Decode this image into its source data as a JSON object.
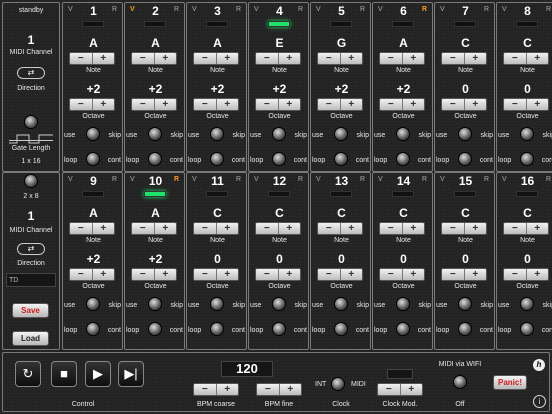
{
  "colors": {
    "accent_orange": "#ff9a1f",
    "led_green": "#1ee36a",
    "save_red": "#d21a1a"
  },
  "left": {
    "status": "standby",
    "midi_channel_top": "1",
    "midi_channel_label": "MIDI Channel",
    "direction_label": "Direction",
    "gate_length_label": "Gate Length",
    "mode_a": "1 x 16",
    "mode_b": "2 x 8",
    "midi_channel_bottom": "1",
    "midi_channel_label_2": "MIDI Channel",
    "direction_label_2": "Direction",
    "preset_field": "TD",
    "save_label": "Save",
    "load_label": "Load"
  },
  "steps": [
    {
      "n": "1",
      "v": "V",
      "r": "R",
      "note": "A",
      "octave": "+2",
      "active": false,
      "v_orange": false,
      "r_orange": false
    },
    {
      "n": "2",
      "v": "V",
      "r": "R",
      "note": "A",
      "octave": "+2",
      "active": false,
      "v_orange": true,
      "r_orange": false
    },
    {
      "n": "3",
      "v": "V",
      "r": "R",
      "note": "A",
      "octave": "+2",
      "active": false,
      "v_orange": false,
      "r_orange": false
    },
    {
      "n": "4",
      "v": "V",
      "r": "R",
      "note": "E",
      "octave": "+2",
      "active": true,
      "v_orange": false,
      "r_orange": false
    },
    {
      "n": "5",
      "v": "V",
      "r": "R",
      "note": "G",
      "octave": "+2",
      "active": false,
      "v_orange": false,
      "r_orange": false
    },
    {
      "n": "6",
      "v": "V",
      "r": "R",
      "note": "A",
      "octave": "+2",
      "active": false,
      "v_orange": false,
      "r_orange": true
    },
    {
      "n": "7",
      "v": "V",
      "r": "R",
      "note": "C",
      "octave": "0",
      "active": false,
      "v_orange": false,
      "r_orange": false
    },
    {
      "n": "8",
      "v": "V",
      "r": "R",
      "note": "C",
      "octave": "0",
      "active": false,
      "v_orange": false,
      "r_orange": false
    },
    {
      "n": "9",
      "v": "V",
      "r": "R",
      "note": "A",
      "octave": "+2",
      "active": false,
      "v_orange": false,
      "r_orange": false
    },
    {
      "n": "10",
      "v": "V",
      "r": "R",
      "note": "A",
      "octave": "+2",
      "active": true,
      "v_orange": false,
      "r_orange": true
    },
    {
      "n": "11",
      "v": "V",
      "r": "R",
      "note": "C",
      "octave": "0",
      "active": false,
      "v_orange": false,
      "r_orange": false
    },
    {
      "n": "12",
      "v": "V",
      "r": "R",
      "note": "C",
      "octave": "0",
      "active": false,
      "v_orange": false,
      "r_orange": false
    },
    {
      "n": "13",
      "v": "V",
      "r": "R",
      "note": "C",
      "octave": "0",
      "active": false,
      "v_orange": false,
      "r_orange": false
    },
    {
      "n": "14",
      "v": "V",
      "r": "R",
      "note": "C",
      "octave": "0",
      "active": false,
      "v_orange": false,
      "r_orange": false
    },
    {
      "n": "15",
      "v": "V",
      "r": "R",
      "note": "C",
      "octave": "0",
      "active": false,
      "v_orange": false,
      "r_orange": false
    },
    {
      "n": "16",
      "v": "V",
      "r": "R",
      "note": "C",
      "octave": "0",
      "active": false,
      "v_orange": false,
      "r_orange": false
    }
  ],
  "step_labels": {
    "note": "Note",
    "octave": "Octave",
    "use": "use",
    "skip": "skip",
    "loop": "loop",
    "cont": "cont",
    "minus": "−",
    "plus": "+"
  },
  "bottom": {
    "control_label": "Control",
    "bpm_value": "120",
    "bpm_coarse_label": "BPM coarse",
    "bpm_fine_label": "BPM fine",
    "clock_int": "INT",
    "clock_midi": "MIDI",
    "clock_label": "Clock",
    "clock_mod_label": "Clock Mod.",
    "wifi_label": "MIDI via WIFI",
    "wifi_state": "Off",
    "panic_label": "Panic!",
    "help_glyph": "i",
    "logo_glyph": "h"
  }
}
